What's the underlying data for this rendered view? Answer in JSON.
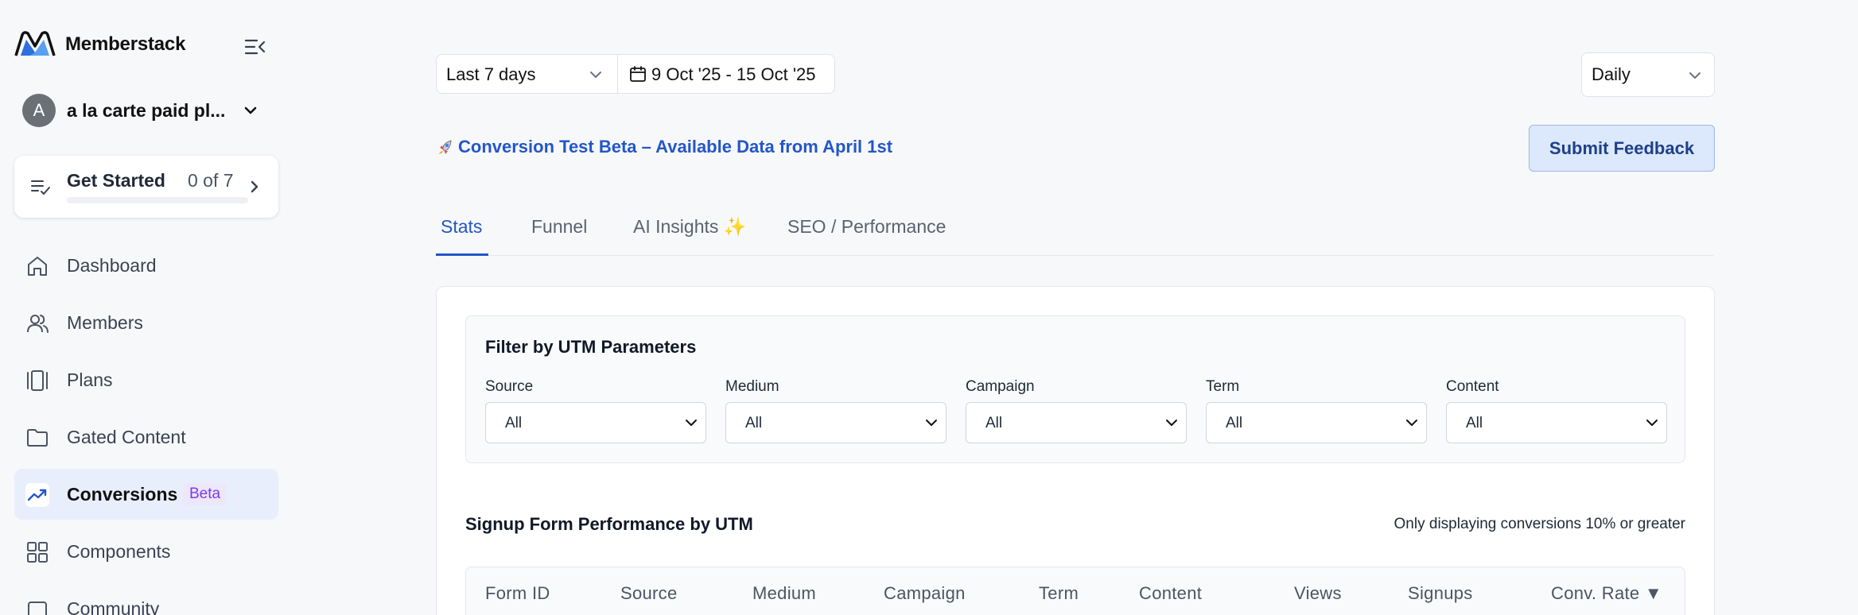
{
  "sidebar": {
    "brand_name": "Memberstack",
    "workspace": {
      "avatar_letter": "A",
      "name": "a la carte paid pl..."
    },
    "get_started": {
      "title": "Get Started",
      "count": "0 of 7",
      "progress": 0
    },
    "nav": [
      {
        "label": "Dashboard",
        "icon": "home-icon"
      },
      {
        "label": "Members",
        "icon": "users-icon"
      },
      {
        "label": "Plans",
        "icon": "plans-icon"
      },
      {
        "label": "Gated Content",
        "icon": "folder-icon"
      },
      {
        "label": "Conversions",
        "icon": "trending-up-icon",
        "badge": "Beta",
        "active": true
      },
      {
        "label": "Components",
        "icon": "grid-icon"
      },
      {
        "label": "Community",
        "icon": "community-icon"
      }
    ]
  },
  "toolbar": {
    "range": "Last 7 days",
    "dates": "9 Oct '25 - 15 Oct '25",
    "interval": "Daily"
  },
  "announcement": {
    "icon": "rocket-icon",
    "text": "Conversion Test Beta – Available Data from April 1st"
  },
  "feedback_button": "Submit Feedback",
  "tabs": [
    {
      "label": "Stats",
      "active": true
    },
    {
      "label": "Funnel"
    },
    {
      "label": "AI Insights ✨"
    },
    {
      "label": "SEO / Performance"
    }
  ],
  "filters": {
    "title": "Filter by UTM Parameters",
    "fields": [
      {
        "label": "Source",
        "value": "All"
      },
      {
        "label": "Medium",
        "value": "All"
      },
      {
        "label": "Campaign",
        "value": "All"
      },
      {
        "label": "Term",
        "value": "All"
      },
      {
        "label": "Content",
        "value": "All"
      }
    ]
  },
  "performance": {
    "title": "Signup Form Performance by UTM",
    "note": "Only displaying conversions 10% or greater",
    "columns": [
      "Form ID",
      "Source",
      "Medium",
      "Campaign",
      "Term",
      "Content",
      "Views",
      "Signups",
      "Conv. Rate ▼"
    ]
  },
  "colors": {
    "accent": "#2356c8",
    "active_nav_bg": "#e8eefc",
    "badge": "#7c3aed"
  }
}
